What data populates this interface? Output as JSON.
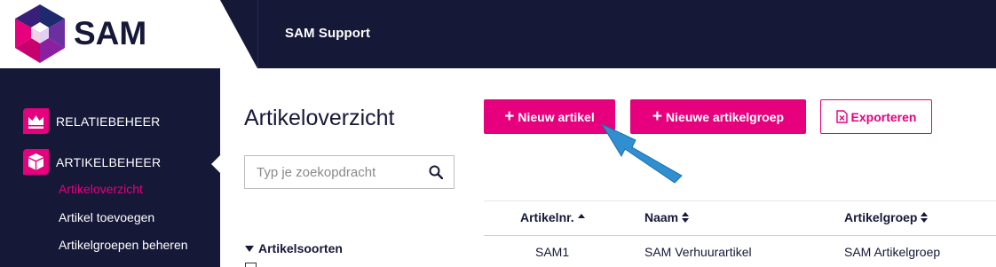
{
  "header": {
    "logo_text": "SAM",
    "app_title": "SAM Support"
  },
  "sidebar": {
    "sections": [
      {
        "label": "RELATIEBEHEER",
        "icon": "crown-icon"
      },
      {
        "label": "ARTIKELBEHEER",
        "icon": "box-icon"
      }
    ],
    "sub_items": [
      {
        "label": "Artikeloverzicht",
        "active": true
      },
      {
        "label": "Artikel toevoegen",
        "active": false
      },
      {
        "label": "Artikelgroepen beheren",
        "active": false
      }
    ]
  },
  "main": {
    "page_title": "Artikeloverzicht",
    "search": {
      "placeholder": "Typ je zoekopdracht",
      "value": ""
    },
    "buttons": {
      "new_article": "Nieuw artikel",
      "new_group": "Nieuwe artikelgroep",
      "export": "Exporteren"
    },
    "filters": {
      "heading": "Artikelsoorten"
    },
    "table": {
      "columns": [
        "Artikelnr.",
        "Naam",
        "Artikelgroep"
      ],
      "rows": [
        [
          "SAM1",
          "SAM Verhuurartikel",
          "SAM Artikelgroep"
        ]
      ]
    }
  },
  "colors": {
    "brand_navy": "#161838",
    "brand_pink": "#e6007e",
    "annotation_arrow": "#2f8fd0"
  }
}
